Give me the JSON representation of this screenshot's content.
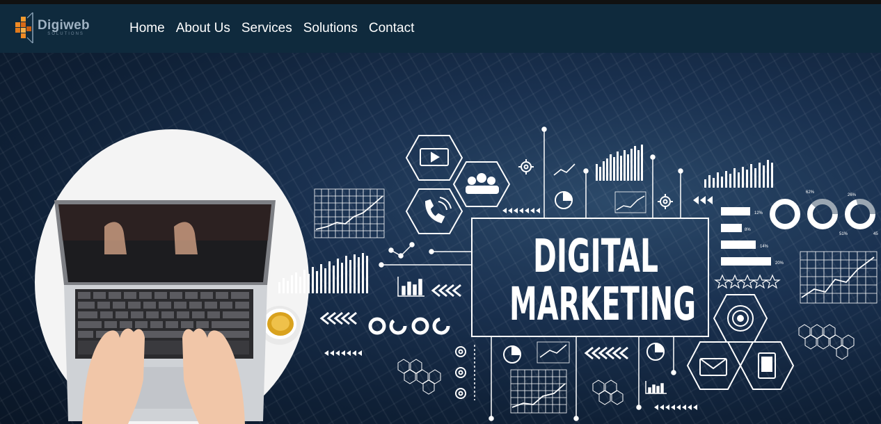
{
  "brand": {
    "name": "Digiweb",
    "tagline": "SOLUTIONS"
  },
  "nav": {
    "items": [
      {
        "label": "Home"
      },
      {
        "label": "About Us"
      },
      {
        "label": "Services"
      },
      {
        "label": "Solutions"
      },
      {
        "label": "Contact"
      }
    ]
  },
  "hero": {
    "headline_line1": "DIGITAL",
    "headline_line2": "MARKETING",
    "donut_labels": [
      "62%",
      "26%",
      "51%",
      "45"
    ],
    "bar_labels": [
      "12%",
      "8%",
      "14%",
      "20%"
    ]
  },
  "colors": {
    "navbar_bg": "#0f2a3d",
    "nav_text": "#ffffff",
    "logo_accent": "#f08a24"
  }
}
